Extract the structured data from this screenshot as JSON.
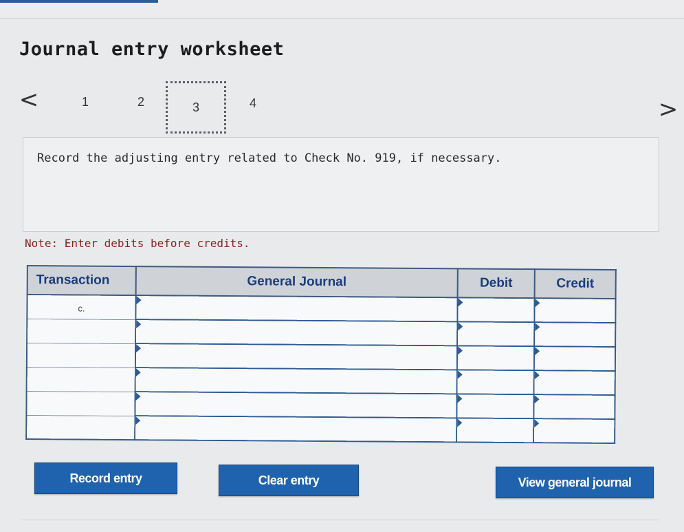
{
  "worksheet": {
    "title": "Journal entry worksheet",
    "pager": {
      "prev_glyph": "<",
      "next_glyph": ">",
      "pages": [
        "1",
        "2",
        "3",
        "4"
      ],
      "active": "3"
    },
    "prompt": "Record the adjusting entry related to Check No. 919, if necessary.",
    "note": "Note: Enter debits before credits."
  },
  "journal": {
    "headers": {
      "transaction": "Transaction",
      "general_journal": "General Journal",
      "debit": "Debit",
      "credit": "Credit"
    },
    "rows": [
      {
        "transaction": "c.",
        "account": "",
        "debit": "",
        "credit": ""
      },
      {
        "transaction": "",
        "account": "",
        "debit": "",
        "credit": ""
      },
      {
        "transaction": "",
        "account": "",
        "debit": "",
        "credit": ""
      },
      {
        "transaction": "",
        "account": "",
        "debit": "",
        "credit": ""
      },
      {
        "transaction": "",
        "account": "",
        "debit": "",
        "credit": ""
      },
      {
        "transaction": "",
        "account": "",
        "debit": "",
        "credit": ""
      }
    ]
  },
  "actions": {
    "record": "Record entry",
    "clear": "Clear entry",
    "view": "View general journal"
  },
  "colors": {
    "button": "#1f62ad",
    "header_text": "#1a3d7a",
    "note_text": "#8a2121",
    "table_border": "#3d5a80"
  },
  "icons": {
    "prev": "chevron-left-icon",
    "next": "chevron-right-icon"
  }
}
